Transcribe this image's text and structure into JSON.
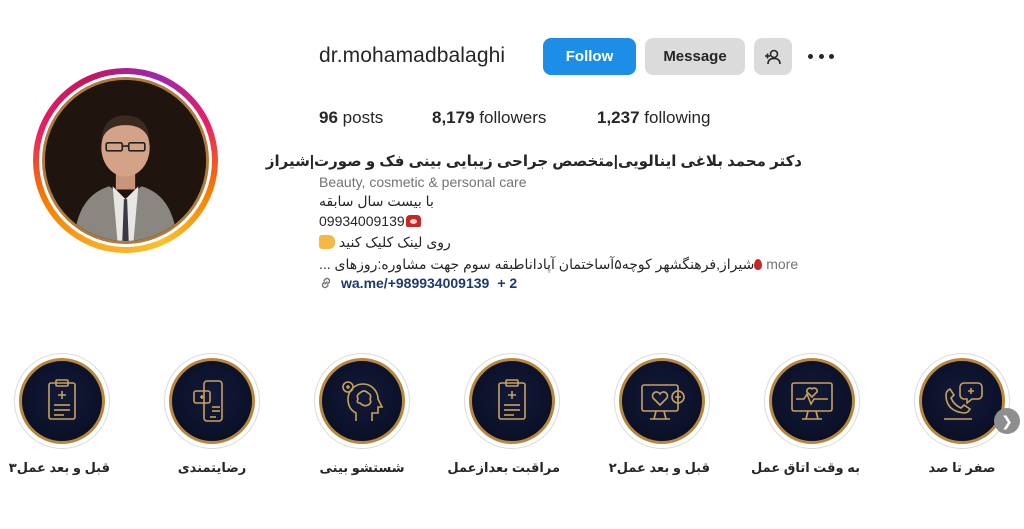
{
  "profile": {
    "username": "dr.mohamadbalaghi",
    "follow_label": "Follow",
    "message_label": "Message",
    "suggest_icon": "add-person-icon",
    "more_icon": "more-options-icon"
  },
  "stats": {
    "posts_count": "96",
    "posts_label": "posts",
    "followers_count": "8,179",
    "followers_label": "followers",
    "following_count": "1,237",
    "following_label": "following"
  },
  "bio": {
    "name": "دکتر محمد بلاغی اینالویی|متخصص جراحی زیبایی بینی فک و صورت|شیراز",
    "category": "Beauty, cosmetic & personal care",
    "line1": "با بیست سال سابقه",
    "line2": "09934009139",
    "line3": "روی لینک کلیک کنید",
    "line4": "شیراز,فرهنگشهر کوچه۵آساختمان آپاداناطبقه سوم جهت مشاوره:روزهای ...",
    "more": "more",
    "link": "wa.me/+989934009139",
    "link_extra": "+ 2"
  },
  "highlights": [
    {
      "label": "قبل و بعد عمل۳",
      "icon": "clipboard-icon"
    },
    {
      "label": "رضایتمندی",
      "icon": "phone-chat-icon"
    },
    {
      "label": "شستشو بینی",
      "icon": "head-brain-icon"
    },
    {
      "label": "مراقبت بعدازعمل",
      "icon": "clipboard-icon"
    },
    {
      "label": "قبل و بعد عمل۲",
      "icon": "monitor-heart-icon"
    },
    {
      "label": "به وقت اتاق عمل",
      "icon": "monitor-pulse-icon"
    },
    {
      "label": "صفر تا صد",
      "icon": "telephone-chat-icon"
    }
  ],
  "colors": {
    "follow": "#1d8ee8",
    "highlight_bg": "#0a0f24",
    "highlight_gold": "#b8883f"
  }
}
